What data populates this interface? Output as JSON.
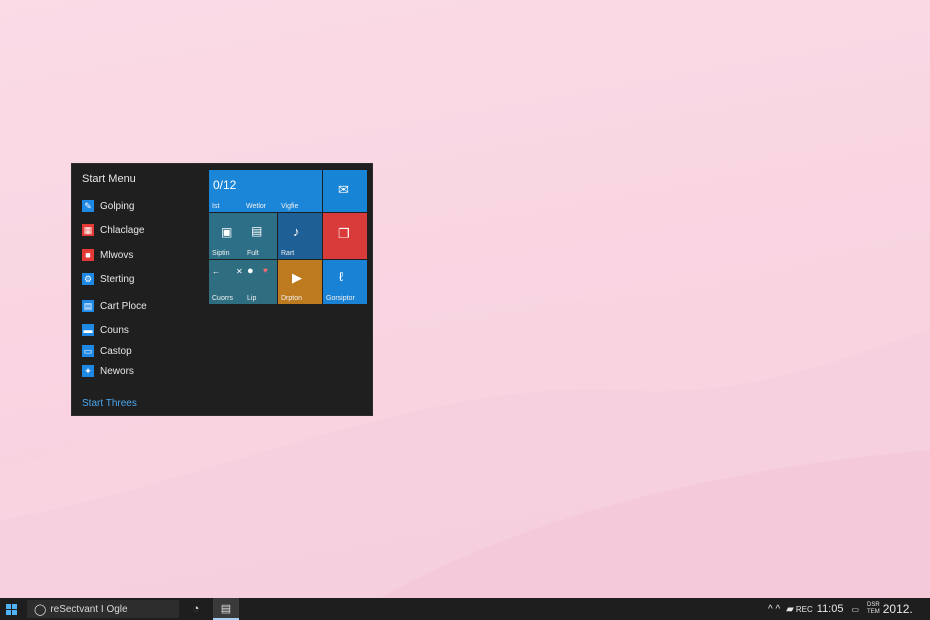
{
  "start_menu": {
    "title": "Start Menu",
    "items": [
      {
        "label": "Golping",
        "icon": "pen-icon",
        "color": "#1e88e5"
      },
      {
        "label": "Chlaclage",
        "icon": "calendar-icon",
        "color": "#e53935"
      },
      {
        "label": "Mlwovs",
        "icon": "media-icon",
        "color": "#e53935"
      },
      {
        "label": "Sterting",
        "icon": "settings-icon",
        "color": "#1e88e5"
      },
      {
        "label": "Cart Ploce",
        "icon": "document-icon",
        "color": "#1e88e5"
      },
      {
        "label": "Couns",
        "icon": "folder-icon",
        "color": "#1e88e5"
      },
      {
        "label": "Castop",
        "icon": "chat-icon",
        "color": "#1e88e5"
      },
      {
        "label": "Newors",
        "icon": "bird-icon",
        "color": "#1e88e5"
      }
    ],
    "footer": "Start Threes"
  },
  "tiles": {
    "wide": {
      "date": "0/12",
      "labels": [
        "Ist",
        "Wetlor",
        "Vigfie"
      ],
      "color": "#1b86d8"
    },
    "mail": {
      "icon": "mail-icon",
      "color": "#1784d6"
    },
    "store": {
      "labels": [
        "Siptin",
        "Fult"
      ],
      "color": "#2c6f86"
    },
    "music": {
      "label": "Rart",
      "icon": "music-icon",
      "color": "#1e5f96"
    },
    "office": {
      "icon": "office-icon",
      "color": "#d93a3a"
    },
    "games": {
      "labels": [
        "Cuorrs",
        "Lip"
      ],
      "color": "#2f6e80"
    },
    "photos": {
      "label": "Drpton",
      "icon": "play-icon",
      "color": "#bd7a1e"
    },
    "edge": {
      "label": "Gorsiptor",
      "icon": "link-icon",
      "color": "#1a82d4"
    }
  },
  "taskbar": {
    "search_text": "reSectvant I Ogle",
    "tray": {
      "chevrons": "^  ^",
      "lang": "REC",
      "time": "11:05",
      "date_top": "DSR",
      "date_bottom": "TEM",
      "year": "2012."
    }
  }
}
